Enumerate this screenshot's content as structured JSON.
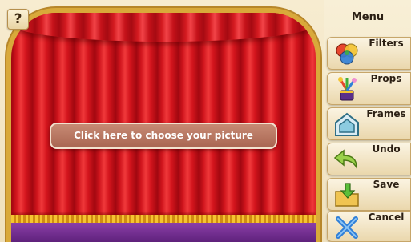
{
  "help": {
    "label": "?"
  },
  "stage": {
    "choose_label": "Click here to choose your picture"
  },
  "menu": {
    "title": "Menu",
    "items": [
      {
        "label": "Filters",
        "icon": "filters-icon"
      },
      {
        "label": "Props",
        "icon": "props-icon"
      },
      {
        "label": "Frames",
        "icon": "frames-icon"
      },
      {
        "label": "Undo",
        "icon": "undo-icon"
      },
      {
        "label": "Save",
        "icon": "save-icon"
      },
      {
        "label": "Cancel",
        "icon": "cancel-icon"
      }
    ]
  },
  "colors": {
    "curtain": "#c40f16",
    "frame_gold": "#d9a93a",
    "floor": "#6b2a8c",
    "panel": "#efe3c4"
  }
}
